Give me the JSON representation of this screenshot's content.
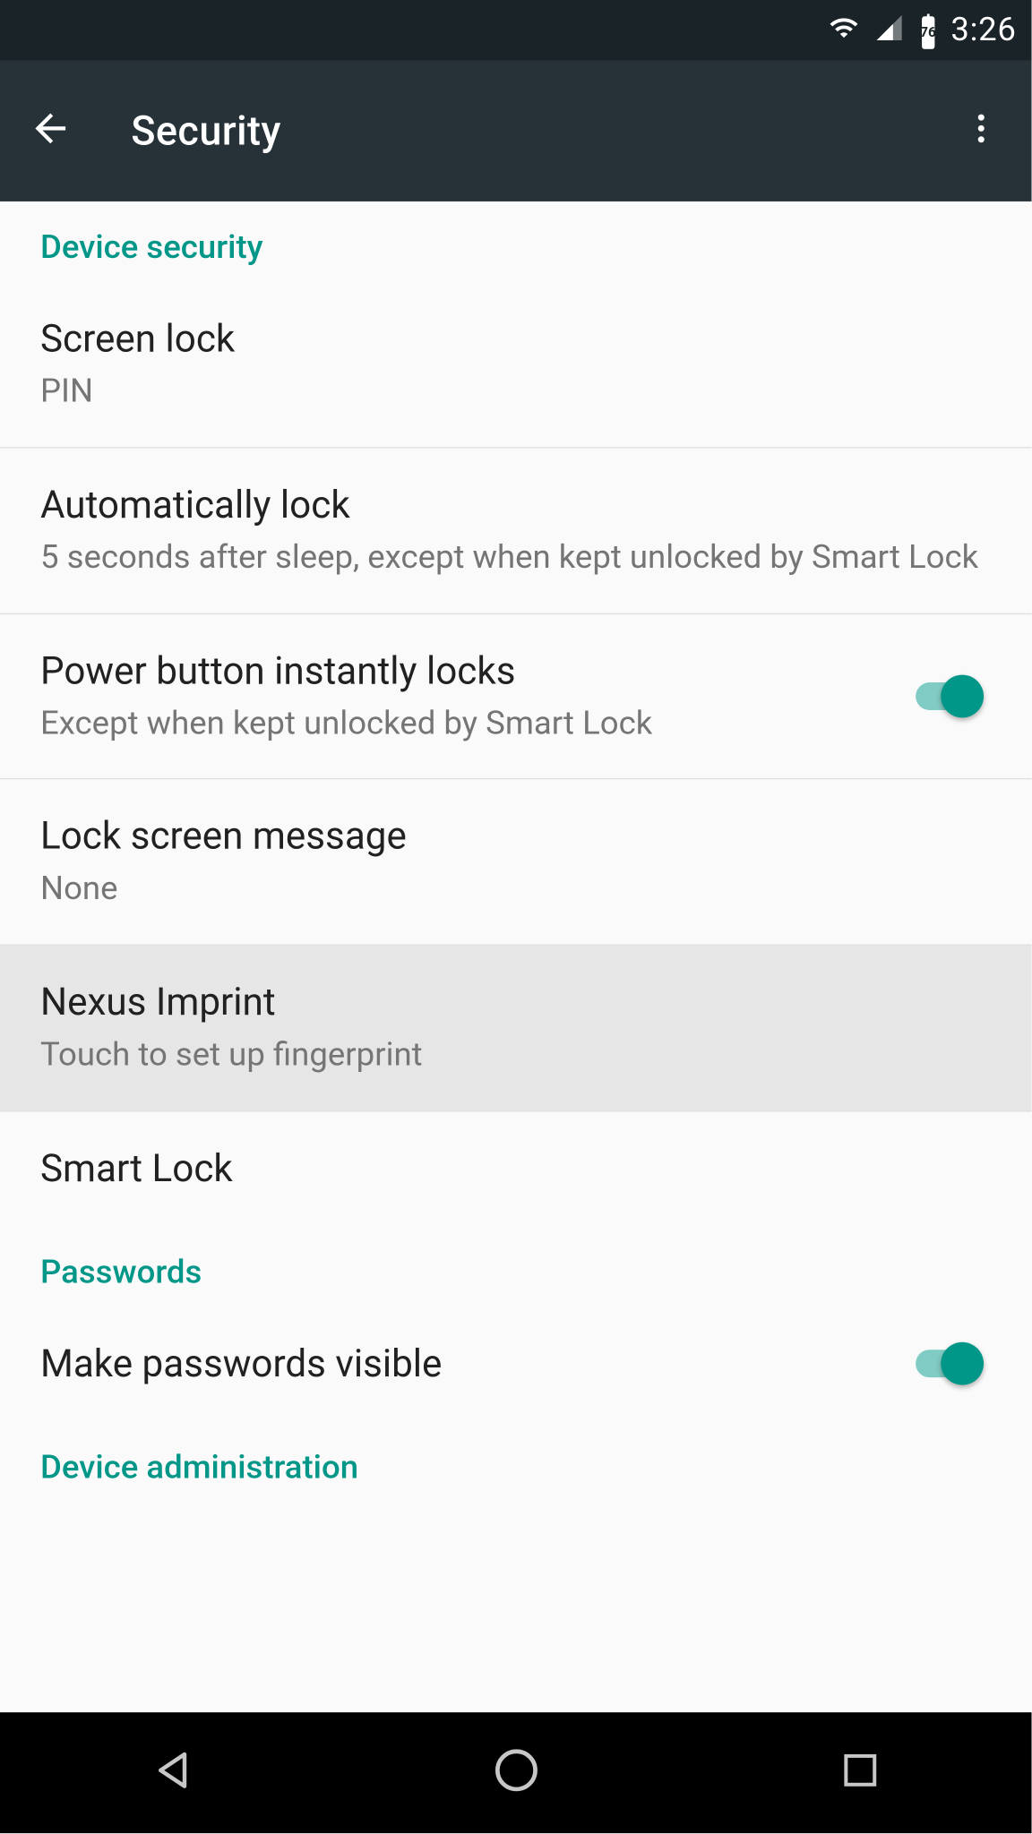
{
  "status_bar": {
    "time": "3:26",
    "battery_pct": "76"
  },
  "app_bar": {
    "title": "Security"
  },
  "sections": {
    "device_security": {
      "header": "Device security",
      "screen_lock": {
        "title": "Screen lock",
        "subtitle": "PIN"
      },
      "auto_lock": {
        "title": "Automatically lock",
        "subtitle": "5 seconds after sleep, except when kept unlocked by Smart Lock"
      },
      "power_lock": {
        "title": "Power button instantly locks",
        "subtitle": "Except when kept unlocked by Smart Lock"
      },
      "lock_msg": {
        "title": "Lock screen message",
        "subtitle": "None"
      },
      "nexus_imprint": {
        "title": "Nexus Imprint",
        "subtitle": "Touch to set up fingerprint"
      },
      "smart_lock": {
        "title": "Smart Lock"
      }
    },
    "passwords": {
      "header": "Passwords",
      "make_visible": {
        "title": "Make passwords visible"
      }
    },
    "device_admin": {
      "header": "Device administration"
    }
  },
  "colors": {
    "accent": "#009688",
    "appbar": "#263238",
    "statusbar": "#1a2327"
  }
}
